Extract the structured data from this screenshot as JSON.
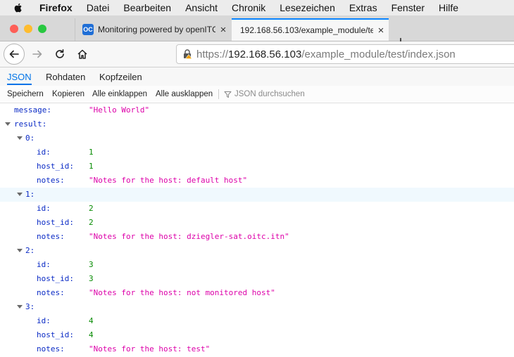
{
  "menubar": {
    "app": "Firefox",
    "items": [
      "Datei",
      "Bearbeiten",
      "Ansicht",
      "Chronik",
      "Lesezeichen",
      "Extras",
      "Fenster",
      "Hilfe"
    ]
  },
  "tabs": [
    {
      "title": "Monitoring powered by openITC",
      "favicon": "OC",
      "close": "×"
    },
    {
      "title": "192.168.56.103/example_module/te",
      "close": "×"
    }
  ],
  "newtab": "+",
  "url": {
    "prefix": "https://",
    "host": "192.168.56.103",
    "path": "/example_module/test/index.json"
  },
  "viewer_tabs": [
    "JSON",
    "Rohdaten",
    "Kopfzeilen"
  ],
  "toolbar": {
    "save": "Speichern",
    "copy": "Kopieren",
    "collapse": "Alle einklappen",
    "expand": "Alle ausklappen",
    "filter_placeholder": "JSON durchsuchen"
  },
  "colors": {
    "accent": "#0074e8",
    "key": "#0b2bc5",
    "string": "#dd00a9",
    "number": "#058b00"
  },
  "json": {
    "message_key": "message:",
    "message_val": "\"Hello World\"",
    "result_key": "result:",
    "items": [
      {
        "index": "0:",
        "id": "1",
        "host_id": "1",
        "notes": "\"Notes for the host: default host\""
      },
      {
        "index": "1:",
        "id": "2",
        "host_id": "2",
        "notes": "\"Notes for the host: dziegler-sat.oitc.itn\""
      },
      {
        "index": "2:",
        "id": "3",
        "host_id": "3",
        "notes": "\"Notes for the host: not monitored host\""
      },
      {
        "index": "3:",
        "id": "4",
        "host_id": "4",
        "notes": "\"Notes for the host: test\""
      }
    ],
    "labels": {
      "id": "id:",
      "host_id": "host_id:",
      "notes": "notes:"
    }
  }
}
